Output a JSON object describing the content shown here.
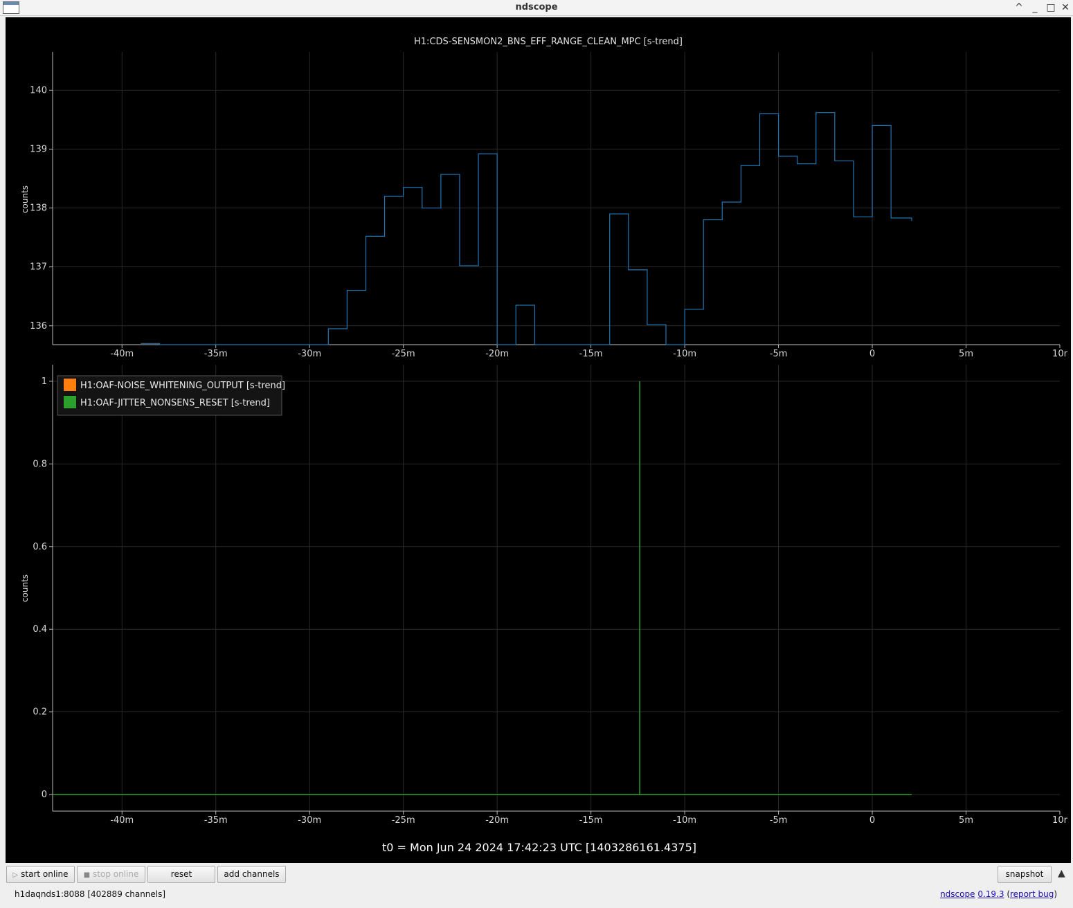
{
  "window": {
    "title": "ndscope"
  },
  "plot_top": {
    "title": "H1:CDS-SENSMON2_BNS_EFF_RANGE_CLEAN_MPC [s-trend]",
    "ylabel": "counts",
    "yticks": [
      "136",
      "137",
      "138",
      "139",
      "140"
    ]
  },
  "plot_bottom": {
    "ylabel": "counts",
    "yticks": [
      "0",
      "0.2",
      "0.4",
      "0.6",
      "0.8",
      "1"
    ],
    "legend": [
      {
        "label": "H1:OAF-NOISE_WHITENING_OUTPUT [s-trend]",
        "color": "#ff7f0e"
      },
      {
        "label": "H1:OAF-JITTER_NONSENS_RESET [s-trend]",
        "color": "#2ca02c"
      }
    ]
  },
  "xticks": [
    "-40m",
    "-35m",
    "-30m",
    "-25m",
    "-20m",
    "-15m",
    "-10m",
    "-5m",
    "0",
    "5m",
    "10r"
  ],
  "t0_label": "t0 = Mon Jun 24 2024 17:42:23 UTC [1403286161.4375]",
  "buttons": {
    "start_online": "start online",
    "stop_online": "stop online",
    "reset": "reset",
    "add_channels": "add channels",
    "snapshot": "snapshot"
  },
  "status": {
    "server": "h1daqnds1:8088  [402889 channels]",
    "app_link": "ndscope",
    "version": "0.19.3",
    "report_bug": "report bug"
  },
  "chart_data": [
    {
      "type": "line",
      "title": "H1:CDS-SENSMON2_BNS_EFF_RANGE_CLEAN_MPC [s-trend]",
      "ylabel": "counts",
      "x_unit": "minutes relative to t0",
      "xlim": [
        -43.7,
        10
      ],
      "ylim": [
        135.68,
        140.65
      ],
      "grid": true,
      "color": "#1f77b4",
      "series": [
        {
          "name": "H1:CDS-SENSMON2_BNS_EFF_RANGE_CLEAN_MPC [s-trend]",
          "steps": [
            [
              -39.0,
              135.7
            ],
            [
              -38.0,
              null
            ],
            [
              -29.0,
              135.95
            ],
            [
              -28.0,
              136.6
            ],
            [
              -27.0,
              137.52
            ],
            [
              -26.0,
              138.2
            ],
            [
              -25.0,
              138.35
            ],
            [
              -24.0,
              138.0
            ],
            [
              -23.0,
              138.57
            ],
            [
              -22.0,
              137.02
            ],
            [
              -21.0,
              138.92
            ],
            [
              -20.0,
              null
            ],
            [
              -19.0,
              136.35
            ],
            [
              -18.0,
              null
            ],
            [
              -14.0,
              137.9
            ],
            [
              -13.0,
              136.95
            ],
            [
              -12.0,
              136.02
            ],
            [
              -11.0,
              null
            ],
            [
              -10.0,
              136.28
            ],
            [
              -9.0,
              137.8
            ],
            [
              -8.0,
              138.1
            ],
            [
              -7.0,
              138.72
            ],
            [
              -6.0,
              139.6
            ],
            [
              -5.0,
              138.88
            ],
            [
              -4.0,
              138.75
            ],
            [
              -3.0,
              139.62
            ],
            [
              -2.0,
              138.8
            ],
            [
              -1.0,
              137.85
            ],
            [
              0.0,
              139.4
            ],
            [
              1.0,
              137.83
            ],
            [
              2.1,
              137.78
            ]
          ]
        }
      ]
    },
    {
      "type": "line",
      "ylabel": "counts",
      "x_unit": "minutes relative to t0",
      "xlim": [
        -43.7,
        10
      ],
      "ylim": [
        -0.04,
        1.04
      ],
      "grid": true,
      "legend": "top-left",
      "series": [
        {
          "name": "H1:OAF-NOISE_WHITENING_OUTPUT [s-trend]",
          "color": "#ff7f0e",
          "x": [
            -43.7,
            2.1
          ],
          "y": [
            0,
            0
          ]
        },
        {
          "name": "H1:OAF-JITTER_NONSENS_RESET [s-trend]",
          "color": "#2ca02c",
          "x": [
            -43.7,
            -12.4,
            -12.4,
            -12.4,
            2.1
          ],
          "y": [
            0,
            0,
            1,
            0,
            0
          ]
        }
      ]
    }
  ]
}
